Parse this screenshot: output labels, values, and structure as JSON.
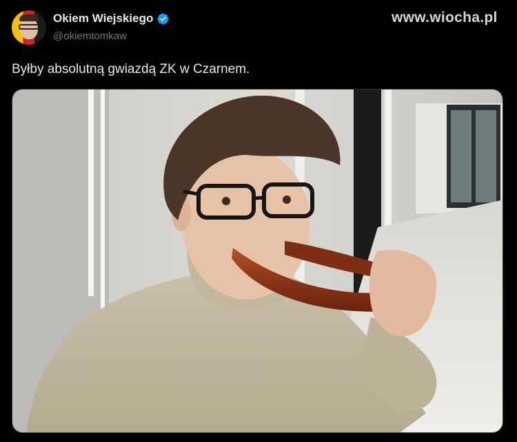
{
  "author": {
    "display_name": "Okiem Wiejskiego",
    "handle": "@okiemtomkaw",
    "verified_icon": "verified-badge-icon",
    "avatar_colors": [
      "#f2c200",
      "#d81e2a",
      "#1b1b1b"
    ]
  },
  "watermark": "www.wiocha.pl",
  "tweet": {
    "text": "Byłby absolutną gwiazdą ZK w Czarnem."
  },
  "media": {
    "description_icon": "photo-selfie-with-sausage"
  },
  "colors": {
    "background": "#000000",
    "text": "#e7e9ea",
    "muted": "#71767b",
    "verified": "#1d9bf0"
  }
}
